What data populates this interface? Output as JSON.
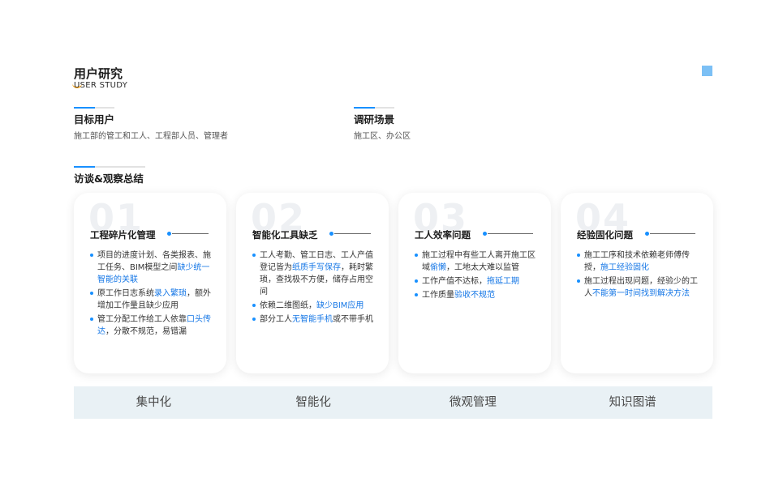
{
  "header": {
    "title": "用户研究",
    "subtitle": "USER STUDY"
  },
  "target_users": {
    "title": "目标用户",
    "desc": "施工部的管工和工人、工程部人员、管理者"
  },
  "scenarios": {
    "title": "调研场景",
    "desc": "施工区、办公区"
  },
  "summary": {
    "title": "访谈&观察总结"
  },
  "cards": [
    {
      "num": "01",
      "title": "工程碎片化管理",
      "items": [
        [
          {
            "t": "项目的进度计划、各类报表、施工任务、BIM模型之间"
          },
          {
            "t": "缺少统一智能的关联",
            "hl": true
          }
        ],
        [
          {
            "t": "原工作日志系统"
          },
          {
            "t": "录入繁琐",
            "hl": true
          },
          {
            "t": "，额外增加工作量且缺少应用"
          }
        ],
        [
          {
            "t": "管工分配工作给工人依靠"
          },
          {
            "t": "口头传达",
            "hl": true
          },
          {
            "t": "，分散不规范，易错漏"
          }
        ]
      ]
    },
    {
      "num": "02",
      "title": "智能化工具缺乏",
      "items": [
        [
          {
            "t": "工人考勤、管工日志、工人产值登记皆为"
          },
          {
            "t": "纸质手写保存",
            "hl": true
          },
          {
            "t": "，耗时繁琐，查找极不方便，储存占用空间"
          }
        ],
        [
          {
            "t": "依赖二维图纸，"
          },
          {
            "t": "缺少BIM应用",
            "hl": true
          }
        ],
        [
          {
            "t": "部分工人"
          },
          {
            "t": "无智能手机",
            "hl": true
          },
          {
            "t": "或不带手机"
          }
        ]
      ]
    },
    {
      "num": "03",
      "title": "工人效率问题",
      "items": [
        [
          {
            "t": "施工过程中有些工人离开施工区域"
          },
          {
            "t": "偷懒",
            "hl": true
          },
          {
            "t": "，工地太大难以监管"
          }
        ],
        [
          {
            "t": "工作产值不达标，"
          },
          {
            "t": "拖延工期",
            "hl": true
          }
        ],
        [
          {
            "t": "工作质量"
          },
          {
            "t": "验收不规范",
            "hl": true
          }
        ]
      ]
    },
    {
      "num": "04",
      "title": "经验固化问题",
      "items": [
        [
          {
            "t": "施工工序和技术依赖老师傅传授，"
          },
          {
            "t": "施工经验固化",
            "hl": true
          }
        ],
        [
          {
            "t": "施工过程出现问题，经验少的工人"
          },
          {
            "t": "不能第一时间找到解决方法",
            "hl": true
          }
        ]
      ]
    }
  ],
  "bottom_tags": [
    "集中化",
    "智能化",
    "微观管理",
    "知识图谱"
  ],
  "colors": {
    "accent": "#1890ff",
    "highlight": "#1677e6",
    "bar_bg": "#e9f1f5",
    "corner": "#7cc0f5"
  }
}
